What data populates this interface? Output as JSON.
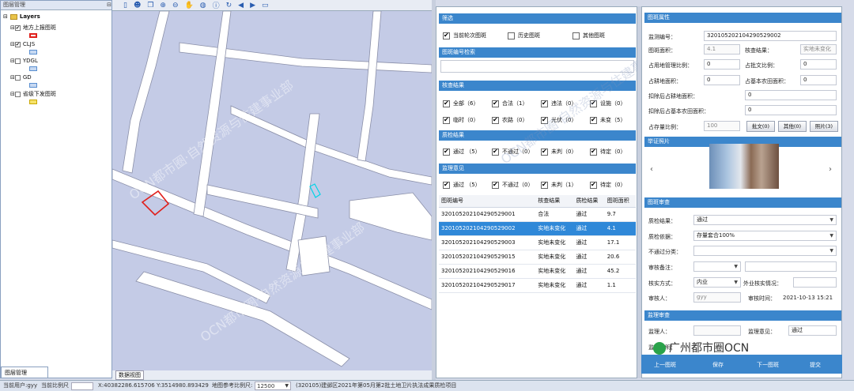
{
  "left_panel": {
    "title": "图层管理",
    "pin": "⊟",
    "layers_root": "Layers",
    "layers": [
      {
        "name": "地方上报图斑",
        "checked": true,
        "swatch_border": "#e0201c",
        "swatch_fill": "#ffffff"
      },
      {
        "name": "CLJS",
        "checked": true,
        "swatch_border": "#5a8fd0",
        "swatch_fill": "#c7d9f2"
      },
      {
        "name": "YDGL",
        "checked": false,
        "swatch_border": "#5a8fd0",
        "swatch_fill": "#c7d9f2"
      },
      {
        "name": "GD",
        "checked": false,
        "swatch_border": "#5a8fd0",
        "swatch_fill": "#c7d9f2"
      },
      {
        "name": "省级下发图斑",
        "checked": false,
        "swatch_border": "#c9a800",
        "swatch_fill": "#f5e26a"
      }
    ],
    "tab": "图层管理"
  },
  "map": {
    "tab": "数据视图",
    "toolbar_icons": [
      "page-icon",
      "user-icon",
      "copy-icon",
      "zoom-in-icon",
      "zoom-out-icon",
      "pan-icon",
      "globe-icon",
      "info-icon",
      "refresh-icon",
      "back-icon",
      "forward-icon",
      "fullscreen-icon"
    ],
    "bg_color": "#c4cbe6"
  },
  "status": {
    "user": "当前用户:gyy",
    "scale_label": "当前比例尺",
    "x": "X:40382286.615706",
    "y": "Y:3514980.893429",
    "ref_scale_label": "地图参考比例尺:",
    "ref_scale": "12500",
    "project": "(320105)建邺区2021年第05月第2批土地卫片执法成果质检项目"
  },
  "filter": {
    "title": "筛选",
    "options": [
      {
        "label": "当前轮次图斑",
        "checked": true
      },
      {
        "label": "历史图斑",
        "checked": false
      },
      {
        "label": "其他图斑",
        "checked": false
      }
    ],
    "search_title": "图斑编号检索",
    "search_value": ""
  },
  "check_result": {
    "title": "核查结果",
    "items": [
      {
        "label": "全部（6）",
        "checked": true
      },
      {
        "label": "合法（1）",
        "checked": true
      },
      {
        "label": "违法（0）",
        "checked": true
      },
      {
        "label": "设施（0）",
        "checked": true
      },
      {
        "label": "临时（0）",
        "checked": true
      },
      {
        "label": "农路（0）",
        "checked": true
      },
      {
        "label": "光伏（0）",
        "checked": true
      },
      {
        "label": "未变（5）",
        "checked": true
      }
    ]
  },
  "quality_result": {
    "title": "质检结果",
    "items": [
      {
        "label": "通过 （5）",
        "checked": true
      },
      {
        "label": "不通过（0）",
        "checked": true
      },
      {
        "label": "未判（0）",
        "checked": true
      },
      {
        "label": "待定（0）",
        "checked": true
      }
    ]
  },
  "supervise": {
    "title": "监理意见",
    "items": [
      {
        "label": "通过 （5）",
        "checked": true
      },
      {
        "label": "不通过（0）",
        "checked": true
      },
      {
        "label": "未判（1）",
        "checked": true
      },
      {
        "label": "待定（0）",
        "checked": true
      }
    ]
  },
  "table": {
    "headers": [
      "图斑编号",
      "核查结果",
      "质检结果",
      "图斑面积"
    ],
    "rows": [
      [
        "320105202104290529001",
        "合法",
        "通过",
        "9.7"
      ],
      [
        "320105202104290529002",
        "实地未变化",
        "通过",
        "4.1"
      ],
      [
        "320105202104290529003",
        "实地未变化",
        "通过",
        "17.1"
      ],
      [
        "320105202104290529015",
        "实地未变化",
        "通过",
        "20.6"
      ],
      [
        "320105202104290529016",
        "实地未变化",
        "通过",
        "45.2"
      ],
      [
        "320105202104290529017",
        "实地未变化",
        "通过",
        "1.1"
      ]
    ],
    "selected_row": 1
  },
  "attributes": {
    "title": "图斑属性",
    "monitor_no_label": "监测编号：",
    "monitor_no": "320105202104290529002",
    "area_label": "图斑面积：",
    "area": "4.1",
    "check_label": "核查结果：",
    "check": "实地未变化",
    "land_ratio_label": "占用地管理比例：",
    "land_ratio": "0",
    "approved_ratio_label": "占批文比例：",
    "approved_ratio": "0",
    "farmland_area_label": "占耕地面积：",
    "farmland_area": "0",
    "basic_area_label": "占基本农田面积：",
    "basic_area": "0",
    "deduct_farmland_label": "扣除后占耕地面积：",
    "deduct_farmland": "0",
    "deduct_basic_label": "扣除后占基本农田面积：",
    "deduct_basic": "0",
    "stock_ratio_label": "占存量比例：",
    "stock_ratio": "100",
    "btn_approval": "批文(0)",
    "btn_other": "其他(0)",
    "btn_photo": "照片(3)"
  },
  "photos": {
    "title": "举证照片",
    "prev": "‹",
    "next": "›"
  },
  "review": {
    "title": "图斑审查",
    "quality_label": "质检结果：",
    "quality": "通过",
    "basis_label": "质检依据：",
    "basis": "存量套合100%",
    "fail_label": "不通过分类：",
    "fail": "",
    "note_label": "审核备注：",
    "note": "",
    "verify_label": "核实方式：",
    "verify": "内业",
    "field_label": "外业核实情况：",
    "field": "",
    "reviewer_label": "审核人：",
    "reviewer": "gyy",
    "time_label": "审核时间：",
    "time": "2021-10-13 15:21"
  },
  "supervision": {
    "title": "监理审查",
    "person_label": "监理人：",
    "person": "",
    "opinion_label": "监理意见：",
    "opinion": "通过",
    "desc_label": "监理说明："
  },
  "actions": {
    "prev": "上一图斑",
    "save": "保存",
    "next": "下一图斑",
    "submit": "提交"
  },
  "watermark": {
    "text": "OCN都市圈·自然资源与住建事业部",
    "logo": "广州都市圈OCN"
  }
}
